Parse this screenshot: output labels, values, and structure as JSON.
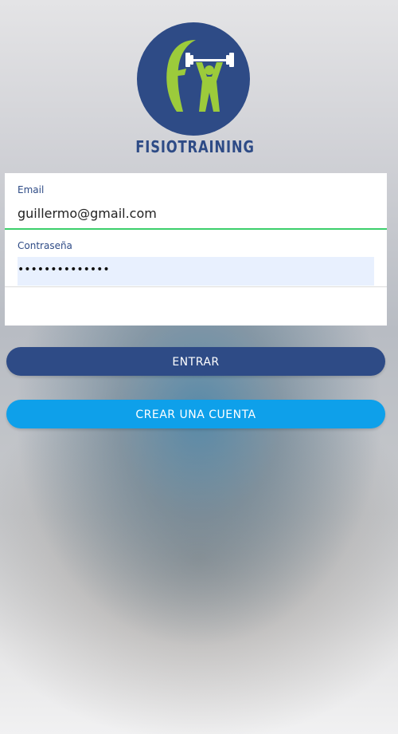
{
  "brand": {
    "name": "FISIOTRAINING",
    "colors": {
      "primary": "#2e4b86",
      "accent": "#9ccb3b",
      "signup": "#0ea0ea",
      "focus": "#3ccf6b"
    },
    "logo_icon": "weightlifter-logo"
  },
  "login_form": {
    "email_label": "Email",
    "email_value": "guillermo@gmail.com",
    "password_label": "Contraseña",
    "password_masked": "••••••••••••••"
  },
  "actions": {
    "login_label": "ENTRAR",
    "signup_label": "CREAR UNA CUENTA"
  }
}
